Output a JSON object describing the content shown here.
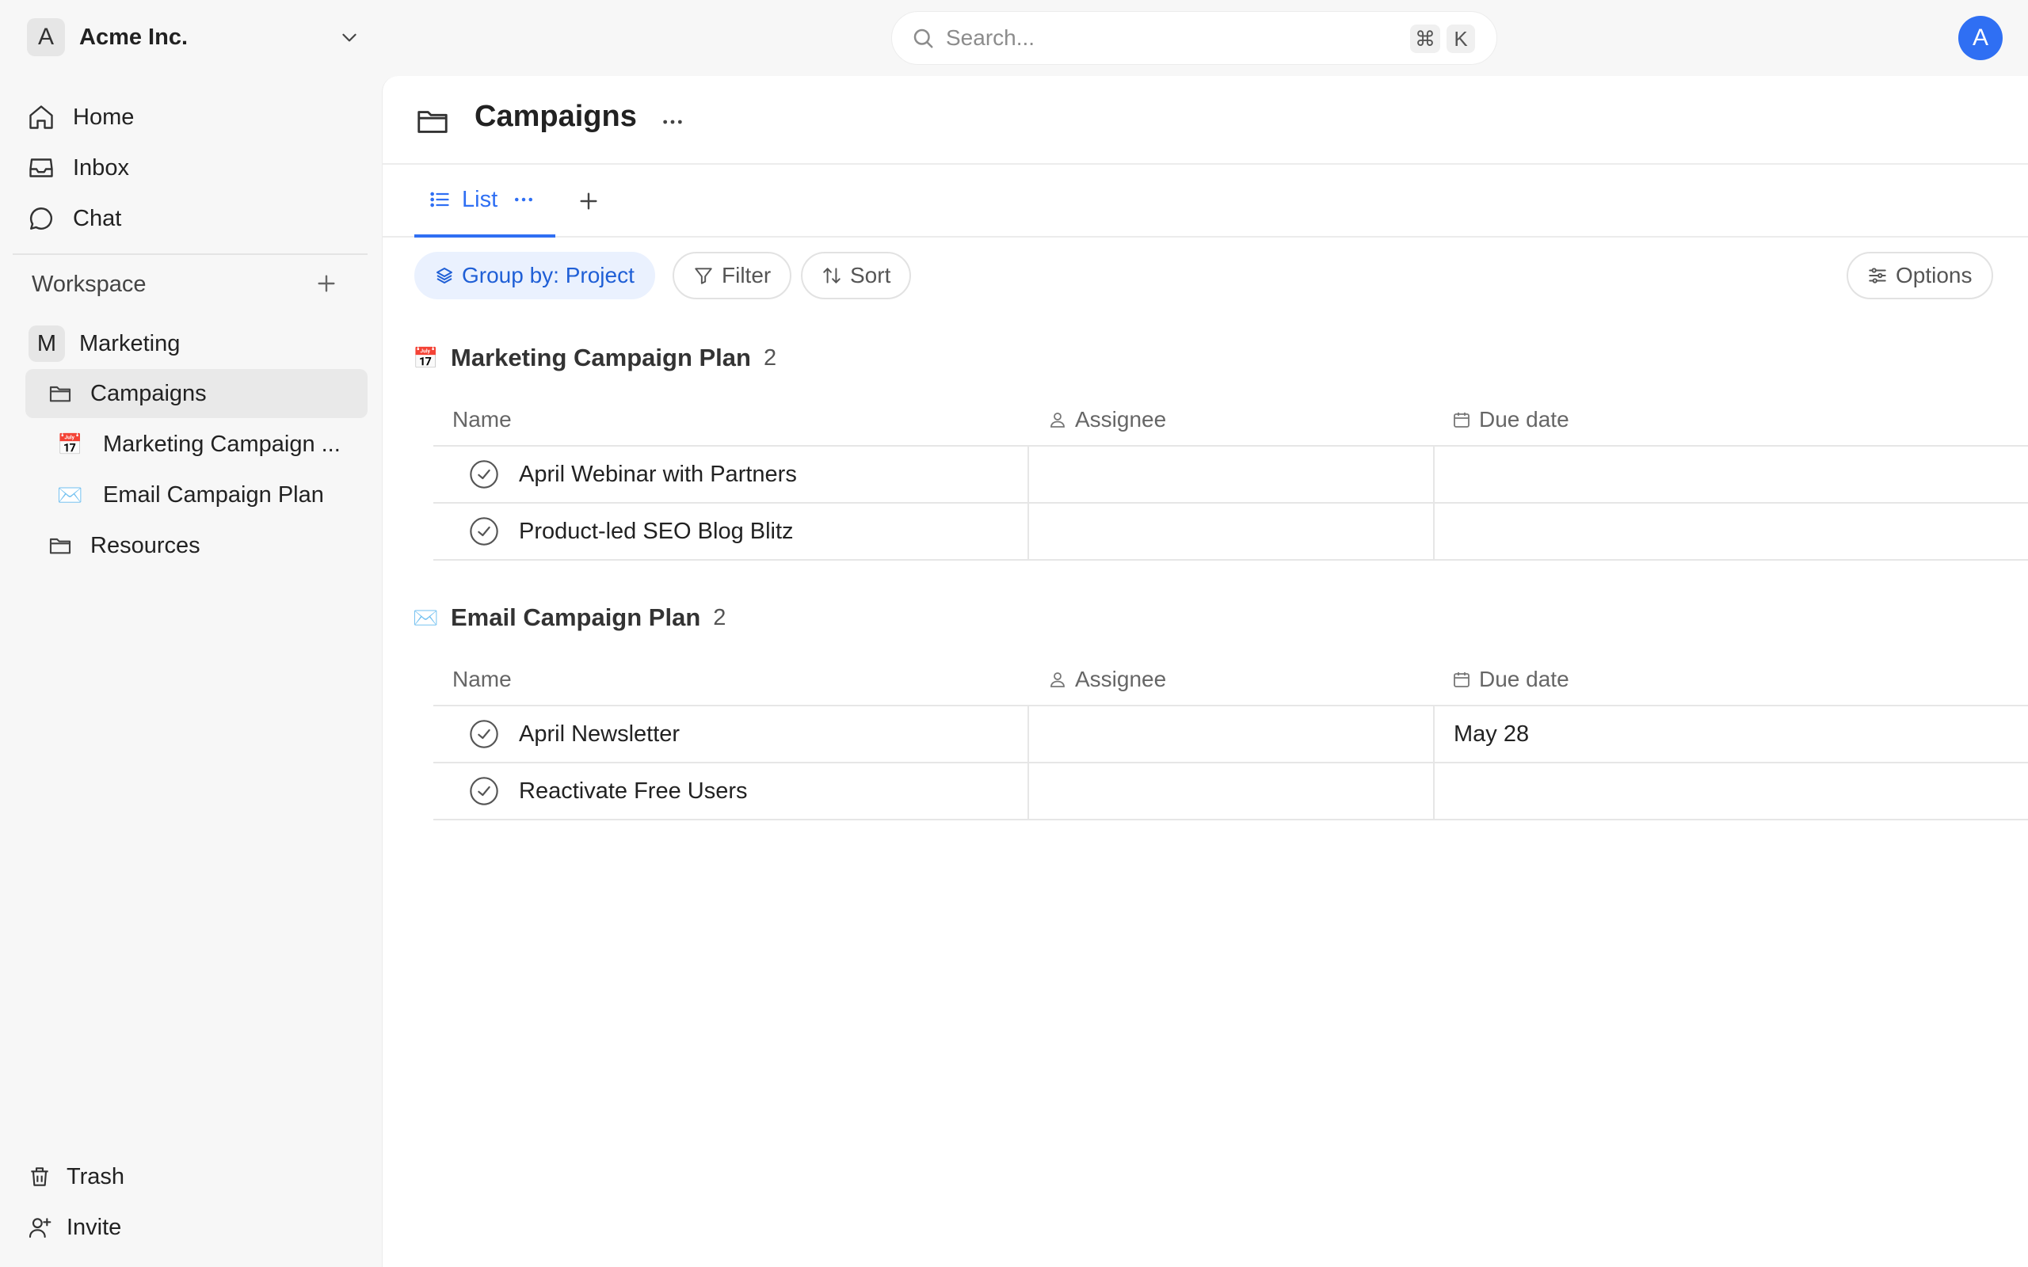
{
  "workspace_switcher": {
    "avatar_letter": "A",
    "name": "Acme Inc."
  },
  "search": {
    "placeholder": "Search...",
    "shortcut_mod": "⌘",
    "shortcut_key": "K"
  },
  "user": {
    "avatar_letter": "A",
    "avatar_color": "#2f6ff3"
  },
  "sidebar": {
    "nav": [
      {
        "label": "Home",
        "icon": "home-icon"
      },
      {
        "label": "Inbox",
        "icon": "inbox-icon"
      },
      {
        "label": "Chat",
        "icon": "chat-icon"
      }
    ],
    "section_title": "Workspace",
    "team": {
      "avatar_letter": "M",
      "name": "Marketing"
    },
    "tree": [
      {
        "label": "Campaigns",
        "icon": "folder-icon",
        "active": true
      },
      {
        "label": "Marketing Campaign ...",
        "icon": "calendar-emoji",
        "emoji": "📅"
      },
      {
        "label": "Email Campaign Plan",
        "icon": "envelope-emoji",
        "emoji": "✉️"
      },
      {
        "label": "Resources",
        "icon": "folder-icon"
      }
    ],
    "footer": [
      {
        "label": "Trash",
        "icon": "trash-icon"
      },
      {
        "label": "Invite",
        "icon": "add-user-icon"
      }
    ]
  },
  "page": {
    "title": "Campaigns"
  },
  "tabs": [
    {
      "label": "List",
      "active": true
    }
  ],
  "toolbar": {
    "group_by": "Group by: Project",
    "filter": "Filter",
    "sort": "Sort",
    "options": "Options"
  },
  "columns": {
    "name": "Name",
    "assignee": "Assignee",
    "due_date": "Due date"
  },
  "groups": [
    {
      "emoji": "📅",
      "title": "Marketing Campaign Plan",
      "count": "2",
      "tasks": [
        {
          "title": "April Webinar with Partners",
          "assignee": "",
          "due": ""
        },
        {
          "title": "Product-led SEO Blog Blitz",
          "assignee": "",
          "due": ""
        }
      ]
    },
    {
      "emoji": "✉️",
      "title": "Email Campaign Plan",
      "count": "2",
      "tasks": [
        {
          "title": "April Newsletter",
          "assignee": "",
          "due": "May 28"
        },
        {
          "title": "Reactivate Free Users",
          "assignee": "",
          "due": ""
        }
      ]
    }
  ],
  "colors": {
    "accent": "#2f6ff3",
    "accent_soft": "#eaf1fe",
    "sidebar_bg": "#f7f7f7"
  }
}
